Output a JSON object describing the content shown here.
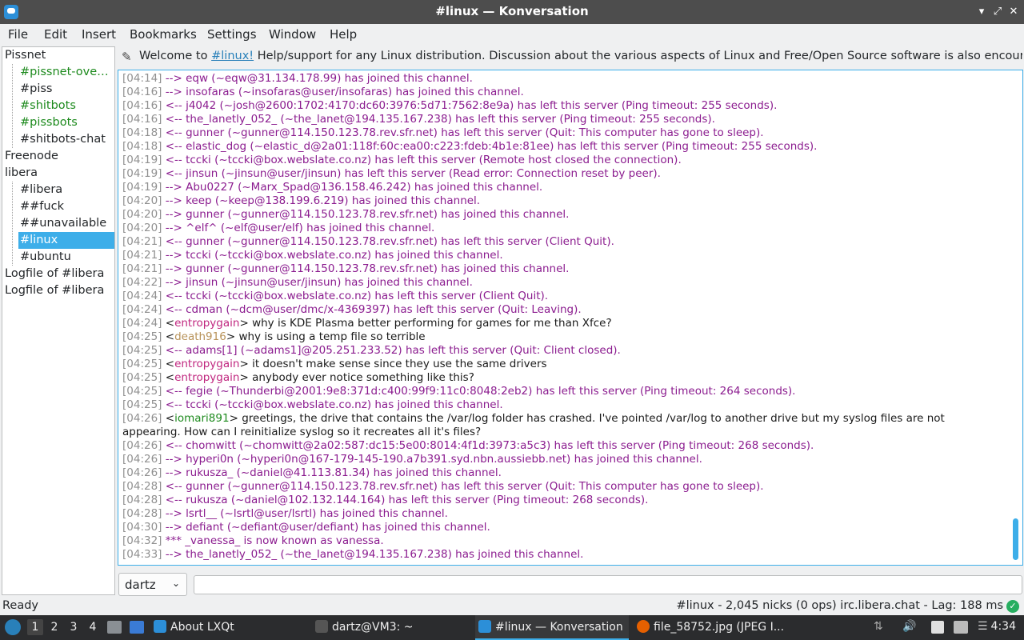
{
  "window": {
    "title": "#linux — Konversation",
    "minimize_glyph": "▾",
    "maximize_glyph": "⤢",
    "close_glyph": "✕"
  },
  "menu": [
    "File",
    "Edit",
    "Insert",
    "Bookmarks",
    "Settings",
    "Window",
    "Help"
  ],
  "sidebar": {
    "items": [
      {
        "label": "Pissnet",
        "color": "#232629"
      },
      {
        "label": "#pissnet-overview",
        "color": "#1d8a1d"
      },
      {
        "label": "#piss",
        "color": "#232629"
      },
      {
        "label": "#shitbots",
        "color": "#1d8a1d"
      },
      {
        "label": "#pissbots",
        "color": "#1d8a1d"
      },
      {
        "label": "#shitbots-chat",
        "color": "#232629"
      },
      {
        "label": "Freenode",
        "color": "#232629"
      },
      {
        "label": "libera",
        "color": "#232629"
      },
      {
        "label": "#libera",
        "color": "#232629"
      },
      {
        "label": "##fuck",
        "color": "#232629"
      },
      {
        "label": "##unavailable",
        "color": "#232629"
      },
      {
        "label": "#linux",
        "color": "#ffffff"
      },
      {
        "label": "#ubuntu",
        "color": "#232629"
      },
      {
        "label": "Logfile of #libera",
        "color": "#232629"
      },
      {
        "label": "Logfile of #libera",
        "color": "#232629"
      }
    ]
  },
  "topic": {
    "prefix": "Welcome to ",
    "link": "#linux!",
    "suffix": " Help/support for any Linux distribution. Discussion about the various aspects of Linux and Free/Open Source software is also encouraged. ..."
  },
  "chat": {
    "nick_colors": {
      "entropygain": "#c0267f",
      "death916": "#b8935a",
      "iomari891": "#1d8a1d"
    },
    "lines": [
      {
        "ts": "[04:14]",
        "type": "sys",
        "text": "--> eqw (~eqw@31.134.178.99) has joined this channel."
      },
      {
        "ts": "[04:16]",
        "type": "sys",
        "text": "--> insofaras (~insofaras@user/insofaras) has joined this channel."
      },
      {
        "ts": "[04:16]",
        "type": "sys",
        "text": "<-- j4042 (~josh@2600:1702:4170:dc60:3976:5d71:7562:8e9a) has left this server (Ping timeout: 255 seconds)."
      },
      {
        "ts": "[04:16]",
        "type": "sys",
        "text": "<-- the_lanetly_052_ (~the_lanet@194.135.167.238) has left this server (Ping timeout: 255 seconds)."
      },
      {
        "ts": "[04:18]",
        "type": "sys",
        "text": "<-- gunner (~gunner@114.150.123.78.rev.sfr.net) has left this server (Quit: This computer has gone to sleep)."
      },
      {
        "ts": "[04:18]",
        "type": "sys",
        "text": "<-- elastic_dog (~elastic_d@2a01:118f:60c:ea00:c223:fdeb:4b1e:81ee) has left this server (Ping timeout: 255 seconds)."
      },
      {
        "ts": "[04:19]",
        "type": "sys",
        "text": "<-- tccki (~tccki@box.webslate.co.nz) has left this server (Remote host closed the connection)."
      },
      {
        "ts": "[04:19]",
        "type": "sys",
        "text": "<-- jinsun (~jinsun@user/jinsun) has left this server (Read error: Connection reset by peer)."
      },
      {
        "ts": "[04:19]",
        "type": "sys",
        "text": "--> Abu0227 (~Marx_Spad@136.158.46.242) has joined this channel."
      },
      {
        "ts": "[04:20]",
        "type": "sys",
        "text": "--> keep (~keep@138.199.6.219) has joined this channel."
      },
      {
        "ts": "[04:20]",
        "type": "sys",
        "text": "--> gunner (~gunner@114.150.123.78.rev.sfr.net) has joined this channel."
      },
      {
        "ts": "[04:20]",
        "type": "sys",
        "text": "--> ^elf^ (~elf@user/elf) has joined this channel."
      },
      {
        "ts": "[04:21]",
        "type": "sys",
        "text": "<-- gunner (~gunner@114.150.123.78.rev.sfr.net) has left this server (Client Quit)."
      },
      {
        "ts": "[04:21]",
        "type": "sys",
        "text": "--> tccki (~tccki@box.webslate.co.nz) has joined this channel."
      },
      {
        "ts": "[04:21]",
        "type": "sys",
        "text": "--> gunner (~gunner@114.150.123.78.rev.sfr.net) has joined this channel."
      },
      {
        "ts": "[04:22]",
        "type": "sys",
        "text": "--> jinsun (~jinsun@user/jinsun) has joined this channel."
      },
      {
        "ts": "[04:24]",
        "type": "sys",
        "text": "<-- tccki (~tccki@box.webslate.co.nz) has left this server (Client Quit)."
      },
      {
        "ts": "[04:24]",
        "type": "sys",
        "text": "<-- cdman (~dcm@user/dmc/x-4369397) has left this server (Quit: Leaving)."
      },
      {
        "ts": "[04:24]",
        "type": "msg",
        "nick": "entropygain",
        "text": "why is KDE Plasma better performing for games for me than Xfce?"
      },
      {
        "ts": "[04:25]",
        "type": "msg",
        "nick": "death916",
        "text": "why is using a temp file so terrible"
      },
      {
        "ts": "[04:25]",
        "type": "sys",
        "text": "<-- adams[1] (~adams1]@205.251.233.52) has left this server (Quit: Client closed)."
      },
      {
        "ts": "[04:25]",
        "type": "msg",
        "nick": "entropygain",
        "text": "it doesn't make sense since they use the same drivers"
      },
      {
        "ts": "[04:25]",
        "type": "msg",
        "nick": "entropygain",
        "text": "anybody ever notice something like this?"
      },
      {
        "ts": "[04:25]",
        "type": "sys",
        "text": "<-- fegie (~Thunderbi@2001:9e8:371d:c400:99f9:11c0:8048:2eb2) has left this server (Ping timeout: 264 seconds)."
      },
      {
        "ts": "[04:25]",
        "type": "sys",
        "text": "<-- tccki (~tccki@box.webslate.co.nz) has joined this channel."
      },
      {
        "ts": "[04:26]",
        "type": "msg",
        "nick": "iomari891",
        "text": "greetings, the drive that contains the /var/log folder has crashed. I've pointed /var/log to another drive but my syslog files are not appearing. How can I reinitialize syslog so it recreates all it's files?"
      },
      {
        "ts": "[04:26]",
        "type": "sys",
        "text": "<-- chomwitt (~chomwitt@2a02:587:dc15:5e00:8014:4f1d:3973:a5c3) has left this server (Ping timeout: 268 seconds)."
      },
      {
        "ts": "[04:26]",
        "type": "sys",
        "text": "--> hyperi0n (~hyperi0n@167-179-145-190.a7b391.syd.nbn.aussiebb.net) has joined this channel."
      },
      {
        "ts": "[04:26]",
        "type": "sys",
        "text": "--> rukusza_ (~daniel@41.113.81.34) has joined this channel."
      },
      {
        "ts": "[04:28]",
        "type": "sys",
        "text": "<-- gunner (~gunner@114.150.123.78.rev.sfr.net) has left this server (Quit: This computer has gone to sleep)."
      },
      {
        "ts": "[04:28]",
        "type": "sys",
        "text": "<-- rukusza (~daniel@102.132.144.164) has left this server (Ping timeout: 268 seconds)."
      },
      {
        "ts": "[04:28]",
        "type": "sys",
        "text": "--> lsrtl__ (~lsrtl@user/lsrtl) has joined this channel."
      },
      {
        "ts": "[04:30]",
        "type": "sys",
        "text": "--> defiant (~defiant@user/defiant) has joined this channel."
      },
      {
        "ts": "[04:32]",
        "type": "sys",
        "text": "*** _vanessa_ is now known as vanessa."
      },
      {
        "ts": "[04:33]",
        "type": "sys",
        "text": "--> the_lanetly_052_ (~the_lanet@194.135.167.238) has joined this channel."
      }
    ]
  },
  "input": {
    "nick": "dartz",
    "chevron": "⌄",
    "message": ""
  },
  "status": {
    "left": "Ready",
    "right": "#linux - 2,045 nicks (0 ops)  irc.libera.chat - Lag: 188 ms",
    "ok_glyph": "✓"
  },
  "taskbar": {
    "workspaces": [
      "1",
      "2",
      "3",
      "4"
    ],
    "tasks": [
      {
        "label": "About LXQt",
        "color": "#2c8fd8"
      },
      {
        "label": "dartz@VM3: ~",
        "color": "#555555"
      },
      {
        "label": "#linux — Konversation",
        "color": "#2c8fd8"
      },
      {
        "label": "file_58752.jpg (JPEG I...",
        "color": "#e66000"
      }
    ],
    "tray_volume": "🔊",
    "clock": "4:34"
  }
}
